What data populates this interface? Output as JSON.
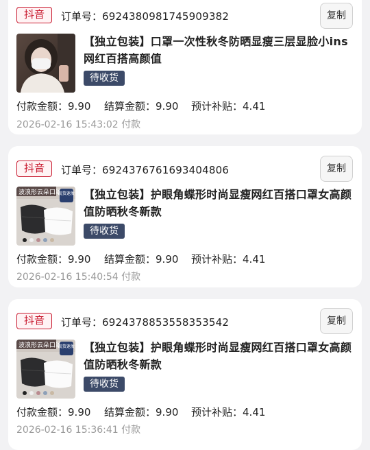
{
  "orders": [
    {
      "platform": "抖音",
      "order_label": "订单号：",
      "order_no": "6924380981745909382",
      "copy": "复制",
      "title": "【独立包装】口罩一次性秋冬防晒显瘦三层显脸小ins网红百搭高颜值",
      "status": "待收货",
      "pay_label": "付款金额：",
      "pay": "9.90",
      "settle_label": "结算金额：",
      "settle": "9.90",
      "subsidy_label": "预计补贴：",
      "subsidy": "4.41",
      "time": "2026-02-16 15:43:02 付款"
    },
    {
      "platform": "抖音",
      "order_label": "订单号：",
      "order_no": "6924376761693404806",
      "copy": "复制",
      "title": "【独立包装】护眼角蝶形时尚显瘦网红百搭口罩女高颜值防晒秋冬新款",
      "status": "待收货",
      "thumb_text_1": "波浪形云朵口罩",
      "thumb_badge": "现货速发",
      "pay_label": "付款金额：",
      "pay": "9.90",
      "settle_label": "结算金额：",
      "settle": "9.90",
      "subsidy_label": "预计补贴：",
      "subsidy": "4.41",
      "time": "2026-02-16 15:40:54 付款"
    },
    {
      "platform": "抖音",
      "order_label": "订单号：",
      "order_no": "6924378853558353542",
      "copy": "复制",
      "title": "【独立包装】护眼角蝶形时尚显瘦网红百搭口罩女高颜值防晒秋冬新款",
      "status": "待收货",
      "thumb_text_1": "波浪形云朵口罩",
      "thumb_badge": "现货速发",
      "pay_label": "付款金额：",
      "pay": "9.90",
      "settle_label": "结算金额：",
      "settle": "9.90",
      "subsidy_label": "预计补贴：",
      "subsidy": "4.41",
      "time": "2026-02-16 15:36:41 付款"
    }
  ],
  "colors": {
    "platform_red": "#c8192e",
    "status_bg": "#3c4a68",
    "background": "#f2f2f4"
  }
}
